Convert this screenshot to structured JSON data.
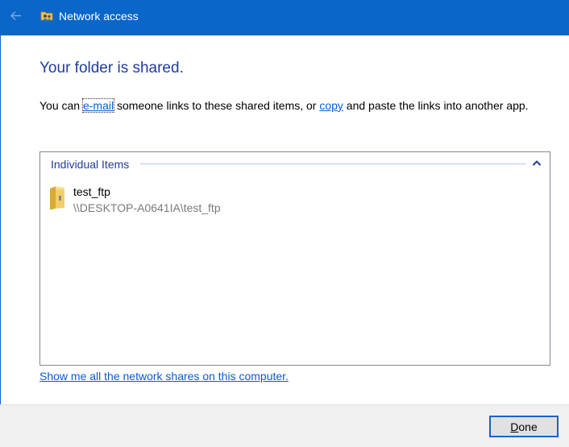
{
  "window": {
    "title": "Network access",
    "back_icon": "back-arrow-icon",
    "app_icon": "network-share-icon",
    "titlebar_color": "#0a66c8"
  },
  "main": {
    "heading": "Your folder is shared.",
    "intro_before": "You can ",
    "email_link": "e-mail",
    "intro_middle": " someone links to these shared items, or ",
    "copy_link": "copy",
    "intro_after": " and paste the links into another app."
  },
  "list": {
    "group_label": "Individual Items",
    "collapse_icon": "chevron-up-icon",
    "items": [
      {
        "name": "test_ftp",
        "path": "\\\\DESKTOP-A0641IA\\test_ftp",
        "icon": "folder-icon"
      }
    ]
  },
  "shares_link": "Show me all the network shares on this computer.",
  "footer": {
    "done_mnemonic": "D",
    "done_rest": "one"
  },
  "colors": {
    "heading": "#1f3d99",
    "link": "#0b5bd3",
    "path_text": "#7a7a7a"
  }
}
